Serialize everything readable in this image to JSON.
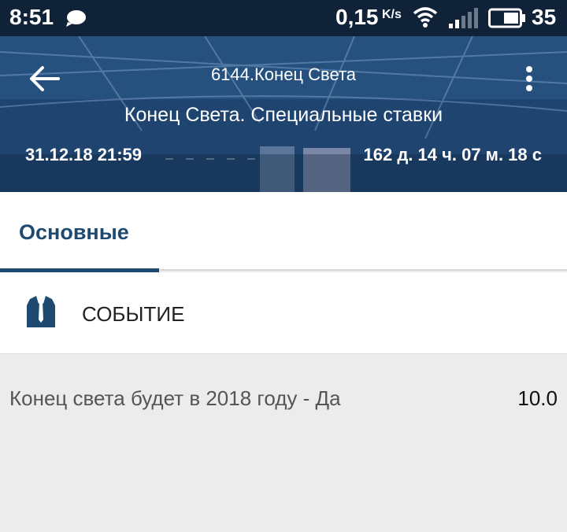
{
  "status_bar": {
    "time": "8:51",
    "speed": "0,15",
    "speed_unit": "K/s",
    "battery": "35",
    "icons": [
      "chat-icon",
      "wifi-icon",
      "signal-icon",
      "battery-icon"
    ]
  },
  "header": {
    "event_id": "6144.Конец Света",
    "title": "Конец Света. Специальные ставки",
    "date": "31.12.18 21:59",
    "countdown": "162 д. 14 ч. 07 м. 18 с",
    "icons": [
      "back-arrow-icon",
      "more-vert-icon"
    ]
  },
  "tabs": [
    {
      "label": "Основные",
      "active": true
    }
  ],
  "section": {
    "title": "СОБЫТИЕ",
    "icon": "suit-tie-icon"
  },
  "bets": [
    {
      "label": "Конец света будет в 2018 году - Да",
      "odds": "10.0"
    }
  ],
  "colors": {
    "accent": "#1e4a72",
    "status_bar_bg": "#0f2238",
    "background": "#ececec"
  }
}
